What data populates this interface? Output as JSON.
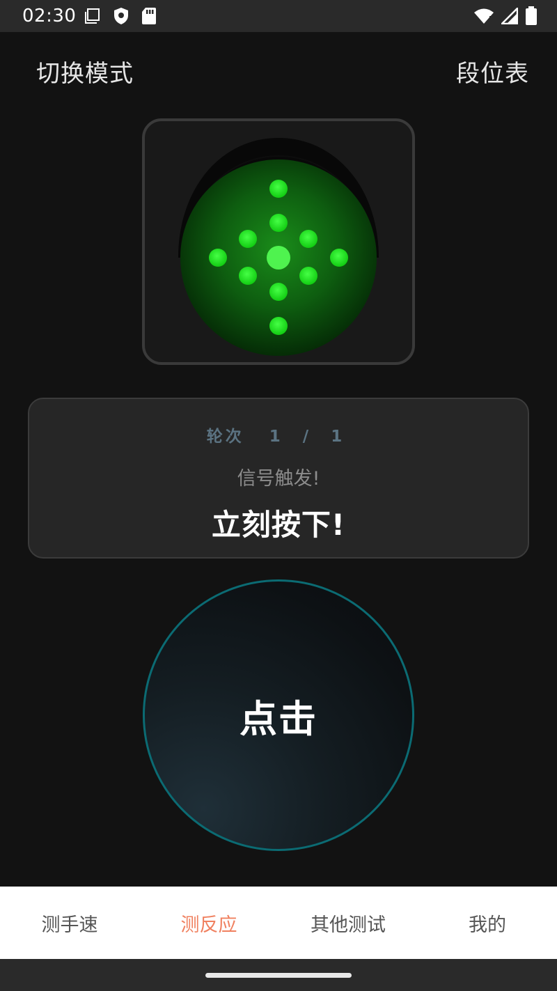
{
  "status_bar": {
    "time": "02:30",
    "left_icons": [
      "screenshot-icon",
      "shield-icon",
      "sd-card-icon"
    ],
    "right_icons": [
      "wifi-icon",
      "cell-signal-icon",
      "battery-icon"
    ]
  },
  "header": {
    "left_label": "切换模式",
    "right_label": "段位表"
  },
  "signal_light": {
    "state": "green",
    "color": "#1ed41e"
  },
  "info_card": {
    "round_label": "轮次",
    "round_current": "1",
    "round_separator": "/",
    "round_total": "1",
    "signal_text": "信号触发!",
    "action_text": "立刻按下!"
  },
  "tap_button": {
    "label": "点击",
    "ring_color": "#0b6b73"
  },
  "bottom_nav": {
    "items": [
      {
        "label": "测手速",
        "active": false
      },
      {
        "label": "测反应",
        "active": true
      },
      {
        "label": "其他测试",
        "active": false
      },
      {
        "label": "我的",
        "active": false
      }
    ],
    "active_color": "#f0805f"
  }
}
